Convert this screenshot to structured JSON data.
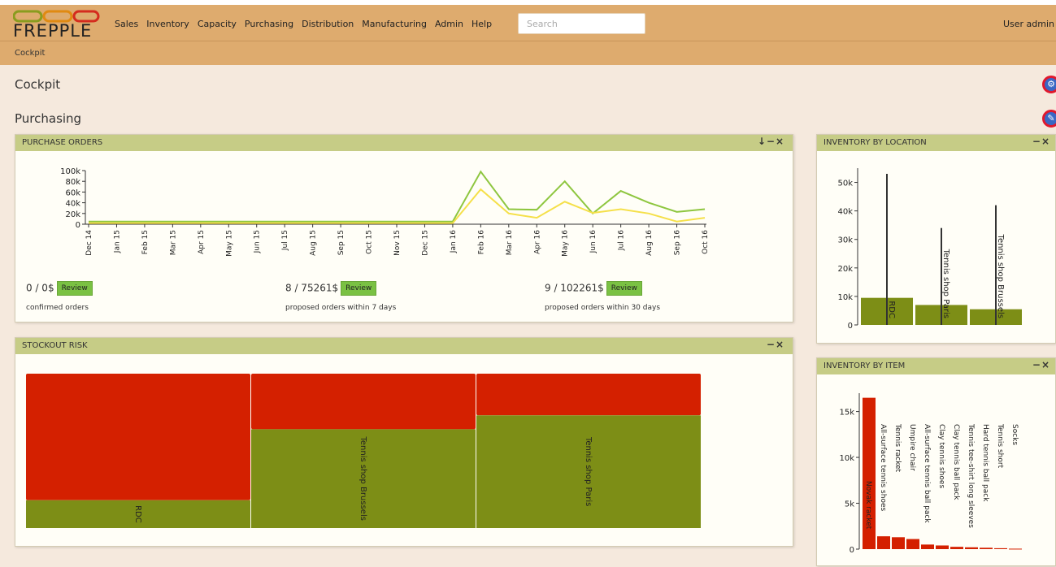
{
  "app": {
    "logo_text": "FREPPLE",
    "nav": [
      "Sales",
      "Inventory",
      "Capacity",
      "Purchasing",
      "Distribution",
      "Manufacturing",
      "Admin",
      "Help"
    ],
    "search_placeholder": "Search",
    "user": "User admin"
  },
  "breadcrumb": "Cockpit",
  "page_title": "Cockpit",
  "section_title": "Purchasing",
  "colors": {
    "header": "#deab6e",
    "panel_head": "#c6cc86",
    "bar_green": "#7d8e16",
    "bar_red": "#d42000",
    "review": "#7ac143"
  },
  "purchase_orders": {
    "title": "PURCHASE ORDERS",
    "tools": "↓−×",
    "stats": [
      {
        "value": "0 / 0$",
        "button": "Review",
        "caption": "confirmed orders"
      },
      {
        "value": "8 / 75261$",
        "button": "Review",
        "caption": "proposed orders within 7 days"
      },
      {
        "value": "9 / 102261$",
        "button": "Review",
        "caption": "proposed orders within 30 days"
      }
    ]
  },
  "stockout": {
    "title": "STOCKOUT RISK",
    "tools": "−×"
  },
  "inv_location": {
    "title": "INVENTORY BY LOCATION",
    "tools": "−×"
  },
  "inv_item": {
    "title": "INVENTORY BY ITEM",
    "tools": "−×"
  },
  "chart_data": [
    {
      "type": "line",
      "x": [
        "Dec 14",
        "Jan 15",
        "Feb 15",
        "Mar 15",
        "Apr 15",
        "May 15",
        "Jun 15",
        "Jul 15",
        "Aug 15",
        "Sep 15",
        "Oct 15",
        "Nov 15",
        "Dec 15",
        "Jan 16",
        "Feb 16",
        "Mar 16",
        "Apr 16",
        "May 16",
        "Jun 16",
        "Jul 16",
        "Aug 16",
        "Sep 16",
        "Oct 16"
      ],
      "ylim": [
        0,
        100000
      ],
      "yticks": [
        "100k",
        "80k",
        "60k",
        "40k",
        "20k",
        "0"
      ],
      "series": [
        {
          "color": "#8ec63f",
          "values": [
            5000,
            5000,
            5000,
            5000,
            5000,
            5000,
            5000,
            5000,
            5000,
            5000,
            5000,
            5000,
            5000,
            5000,
            98000,
            28000,
            27000,
            80000,
            20000,
            62000,
            40000,
            23000,
            28000
          ]
        },
        {
          "color": "#f5e04a",
          "values": [
            2000,
            2000,
            2000,
            2000,
            2000,
            2000,
            2000,
            2000,
            2000,
            2000,
            2000,
            2000,
            2000,
            2000,
            65000,
            20000,
            12000,
            42000,
            21000,
            28000,
            20000,
            5000,
            12000
          ]
        }
      ]
    },
    {
      "type": "heatmap",
      "categories": [
        "RDC",
        "Tennis shop Brussels",
        "Tennis shop Paris"
      ],
      "risk_fraction": [
        0.82,
        0.36,
        0.27
      ]
    },
    {
      "type": "bar",
      "categories": [
        "RDC",
        "Tennis shop Paris",
        "Tennis shop Brussels"
      ],
      "values": [
        9500,
        7000,
        5500
      ],
      "max_values": [
        53000,
        34000,
        42000
      ],
      "ylim": [
        0,
        55000
      ],
      "yticks": [
        "50k",
        "40k",
        "30k",
        "20k",
        "10k",
        "0"
      ]
    },
    {
      "type": "bar",
      "categories": [
        "Novak racket",
        "All-surface tennis shoes",
        "Tennis racket",
        "Umpire chair",
        "All-surface tennis ball pack",
        "Clay tennis shoes",
        "Clay tennis ball pack",
        "Tennis tee-shirt long sleeves",
        "Hard tennis ball pack",
        "Tennis short",
        "Socks"
      ],
      "values": [
        16500,
        1400,
        1300,
        1100,
        500,
        400,
        250,
        200,
        150,
        100,
        50
      ],
      "ylim": [
        0,
        17000
      ],
      "yticks": [
        "15k",
        "10k",
        "5k",
        "0"
      ]
    }
  ]
}
